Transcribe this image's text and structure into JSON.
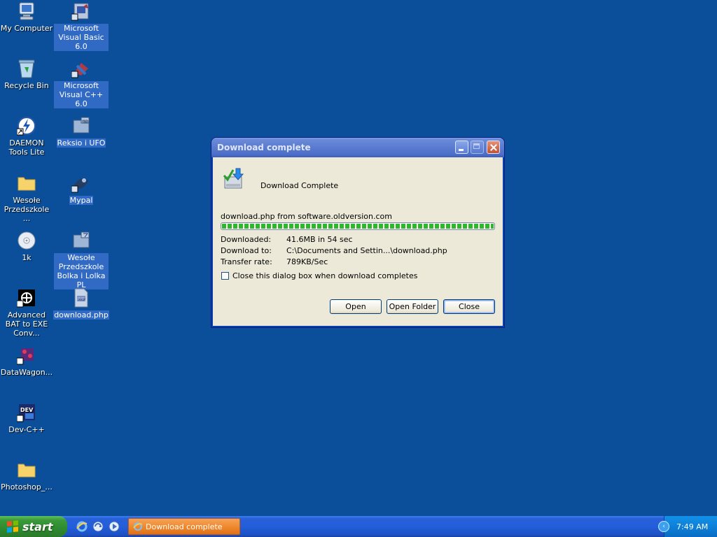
{
  "desktop": {
    "icons": [
      {
        "label": "My Computer",
        "icon": "my-computer-icon"
      },
      {
        "label": "Microsoft Visual Basic 6.0",
        "icon": "visual-basic-icon",
        "selected": true
      },
      {
        "label": "Recycle Bin",
        "icon": "recycle-bin-icon"
      },
      {
        "label": "Microsoft Visual C++ 6.0",
        "icon": "visual-cpp-icon",
        "selected": true
      },
      {
        "label": "DAEMON Tools Lite",
        "icon": "daemon-tools-icon"
      },
      {
        "label": "Reksio i UFO",
        "icon": "iso-file-icon",
        "selected": true
      },
      {
        "label": "Wesołe Przedszkole ...",
        "icon": "folder-icon"
      },
      {
        "label": "Mypal",
        "icon": "mypal-icon",
        "selected": true
      },
      {
        "label": "1k",
        "icon": "cd-icon"
      },
      {
        "label": "Wesołe Przedszkole Bolka i Lolka PL",
        "icon": "file-icon",
        "selected": true
      },
      {
        "label": "Advanced BAT to EXE Conv...",
        "icon": "bat-to-exe-icon"
      },
      {
        "label": "download.php",
        "icon": "php-file-icon",
        "selected": true
      },
      {
        "label": "DataWagon...",
        "icon": "datawagon-icon"
      },
      {
        "label": "Dev-C++",
        "icon": "dev-cpp-icon"
      },
      {
        "label": "Photoshop_...",
        "icon": "folder-icon"
      }
    ]
  },
  "dialog": {
    "title": "Download complete",
    "heading": "Download Complete",
    "source": "download.php from software.oldversion.com",
    "progress": 1.0,
    "downloaded_label": "Downloaded:",
    "downloaded_value": "41.6MB in 54 sec",
    "download_to_label": "Download to:",
    "download_to_value": "C:\\Documents and Settin...\\download.php",
    "transfer_rate_label": "Transfer rate:",
    "transfer_rate_value": "789KB/Sec",
    "checkbox_label": "Close this dialog box when download completes",
    "checkbox_checked": false,
    "buttons": {
      "open": "Open",
      "open_folder": "Open Folder",
      "close": "Close"
    }
  },
  "taskbar": {
    "start_label": "start",
    "task_label": "Download complete",
    "clock": "7:49 AM"
  },
  "colors": {
    "desktop_bg": "#0b4f9a",
    "progress_fill": "#2bb92b",
    "task_active": "#f08a2e"
  }
}
